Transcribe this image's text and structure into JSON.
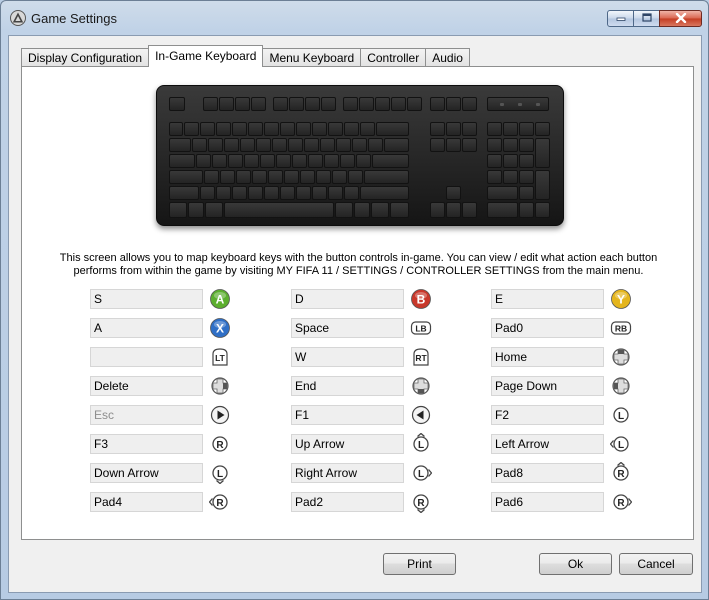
{
  "window": {
    "title": "Game Settings",
    "app_icon": "triangle-logo-icon",
    "controls": [
      "minimize-icon",
      "maximize-icon",
      "close-icon"
    ]
  },
  "tabs": [
    {
      "label": "Display Configuration",
      "active": false
    },
    {
      "label": "In-Game Keyboard",
      "active": true
    },
    {
      "label": "Menu Keyboard",
      "active": false
    },
    {
      "label": "Controller",
      "active": false
    },
    {
      "label": "Audio",
      "active": false
    }
  ],
  "description_line1": "This screen allows you to map keyboard keys with the button controls in-game. You can view / edit what action each button",
  "description_line2": "performs from within the game by visiting MY FIFA 11 / SETTINGS / CONTROLLER SETTINGS from the main menu.",
  "mappings": [
    [
      {
        "value": "S",
        "icon": "a-button-icon",
        "dim": false
      },
      {
        "value": "A",
        "icon": "x-button-icon",
        "dim": false
      },
      {
        "value": "",
        "icon": "lt-trigger-icon",
        "dim": false
      },
      {
        "value": "Delete",
        "icon": "dpad-right-icon",
        "dim": false
      },
      {
        "value": "Esc",
        "icon": "start-button-icon",
        "dim": true
      },
      {
        "value": "F3",
        "icon": "right-stick-press-icon",
        "dim": false
      },
      {
        "value": "Down Arrow",
        "icon": "left-stick-down-icon",
        "dim": false
      },
      {
        "value": "Pad4",
        "icon": "right-stick-left-icon",
        "dim": false
      }
    ],
    [
      {
        "value": "D",
        "icon": "b-button-icon",
        "dim": false
      },
      {
        "value": "Space",
        "icon": "lb-bumper-icon",
        "dim": false
      },
      {
        "value": "W",
        "icon": "rt-trigger-icon",
        "dim": false
      },
      {
        "value": "End",
        "icon": "dpad-down-icon",
        "dim": false
      },
      {
        "value": "F1",
        "icon": "back-button-icon",
        "dim": false
      },
      {
        "value": "Up Arrow",
        "icon": "left-stick-up-icon",
        "dim": false
      },
      {
        "value": "Right Arrow",
        "icon": "left-stick-right-icon",
        "dim": false
      },
      {
        "value": "Pad2",
        "icon": "right-stick-down-icon",
        "dim": false
      }
    ],
    [
      {
        "value": "E",
        "icon": "y-button-icon",
        "dim": false
      },
      {
        "value": "Pad0",
        "icon": "rb-bumper-icon",
        "dim": false
      },
      {
        "value": "Home",
        "icon": "dpad-up-icon",
        "dim": false
      },
      {
        "value": "Page Down",
        "icon": "dpad-left-icon",
        "dim": false
      },
      {
        "value": "F2",
        "icon": "left-stick-press-icon",
        "dim": false
      },
      {
        "value": "Left Arrow",
        "icon": "left-stick-left-icon",
        "dim": false
      },
      {
        "value": "Pad8",
        "icon": "right-stick-up-icon",
        "dim": false
      },
      {
        "value": "Pad6",
        "icon": "right-stick-right-icon",
        "dim": false
      }
    ]
  ],
  "buttons": {
    "print": "Print",
    "ok": "Ok",
    "cancel": "Cancel"
  },
  "colors": {
    "a_button": "#5cae2e",
    "b_button": "#c8382b",
    "x_button": "#2f6fc6",
    "y_button": "#e4b51d"
  }
}
